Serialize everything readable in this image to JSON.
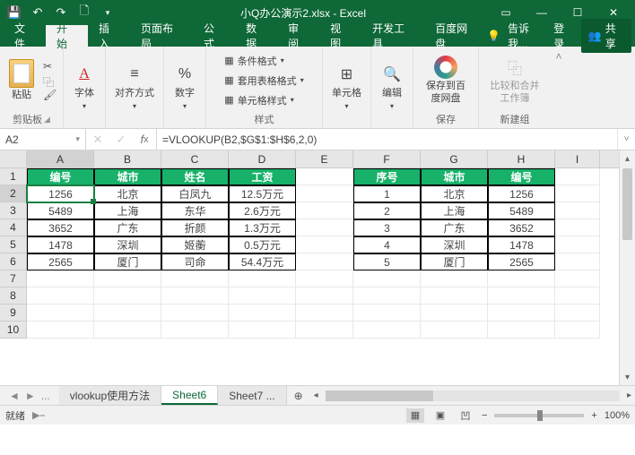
{
  "titlebar": {
    "title": "小Q办公演示2.xlsx - Excel"
  },
  "tabs": {
    "file": "文件",
    "home": "开始",
    "insert": "插入",
    "layout": "页面布局",
    "formulas": "公式",
    "data": "数据",
    "review": "审阅",
    "view": "视图",
    "dev": "开发工具",
    "baidu": "百度网盘",
    "tell_me": "告诉我...",
    "login": "登录",
    "share": "共享"
  },
  "ribbon": {
    "paste": "粘贴",
    "clipboard": "剪贴板",
    "font": "字体",
    "align": "对齐方式",
    "number": "数字",
    "cond_fmt": "条件格式",
    "tbl_fmt": "套用表格格式",
    "cell_fmt": "单元格样式",
    "styles": "样式",
    "cells": "单元格",
    "editing": "编辑",
    "save_baidu": "保存到百度网盘",
    "baidu_group": "保存",
    "compare": "比较和合并工作簿",
    "new_group": "新建组"
  },
  "namebox": "A2",
  "formula": "=VLOOKUP(B2,$G$1:$H$6,2,0)",
  "cols": [
    "A",
    "B",
    "C",
    "D",
    "E",
    "F",
    "G",
    "H",
    "I"
  ],
  "rows": [
    "1",
    "2",
    "3",
    "4",
    "5",
    "6",
    "7",
    "8",
    "9",
    "10"
  ],
  "table1": {
    "headers": [
      "编号",
      "城市",
      "姓名",
      "工资"
    ],
    "rows": [
      [
        "1256",
        "北京",
        "白凤九",
        "12.5万元"
      ],
      [
        "5489",
        "上海",
        "东华",
        "2.6万元"
      ],
      [
        "3652",
        "广东",
        "折颜",
        "1.3万元"
      ],
      [
        "1478",
        "深圳",
        "姬蘅",
        "0.5万元"
      ],
      [
        "2565",
        "厦门",
        "司命",
        "54.4万元"
      ]
    ]
  },
  "table2": {
    "headers": [
      "序号",
      "城市",
      "编号"
    ],
    "rows": [
      [
        "1",
        "北京",
        "1256"
      ],
      [
        "2",
        "上海",
        "5489"
      ],
      [
        "3",
        "广东",
        "3652"
      ],
      [
        "4",
        "深圳",
        "1478"
      ],
      [
        "5",
        "厦门",
        "2565"
      ]
    ]
  },
  "sheets": {
    "nav_prev": "◄",
    "nav_next": "►",
    "ellipsis": "...",
    "s1": "vlookup使用方法",
    "s2": "Sheet6",
    "s3": "Sheet7",
    "s3_more": "...",
    "add": "⊕"
  },
  "status": {
    "ready": "就绪",
    "zoom": "100%",
    "minus": "−",
    "plus": "+"
  }
}
